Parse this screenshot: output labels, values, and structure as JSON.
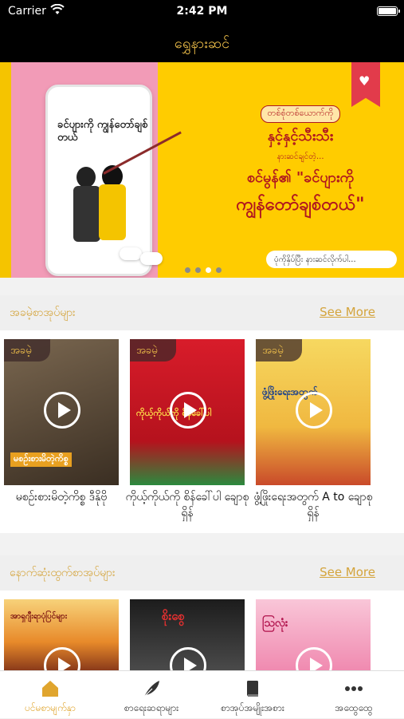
{
  "status_bar": {
    "carrier": "Carrier",
    "time": "2:42 PM"
  },
  "nav": {
    "title": "ရွှေနားဆင်"
  },
  "banner": {
    "phone_book_title": "ခင်ပျားကို ကျွန်တော်ချစ်တယ်",
    "promo_line1": "တစ်စုံတစ်ယောက်ကို",
    "promo_line2": "နှင့်နှင့်သီးသီး",
    "promo_line3": "နားဆင်ချင်တဲ့...",
    "promo_line4": "စင်မွန်၏ \"ခင်ပျားကို",
    "promo_line5": "ကျွန်တော်ချစ်တယ်\"",
    "caption": "ပုံကိုနှိပ်ပြီး နားဆင်လိုက်ပါ...",
    "slide_count": 4,
    "active_slide": 3
  },
  "sections": [
    {
      "title": "အခမဲ့စာအုပ်များ",
      "see_more": "See More",
      "books": [
        {
          "tag": "အခမဲ့",
          "cover_text": "မစဥ်းစားမိတဲ့ကိစ္စ",
          "caption": "မစဥ်းစားမိတဲ့ကိစ္စ ဒီနိုဗို",
          "colors": [
            "#6b5a45",
            "#3d3024"
          ]
        },
        {
          "tag": "အခမဲ့",
          "cover_text": "ကိုယ့်ကိုယ်ကို စိန်ခေါ်ပါ",
          "caption": "ကိုယ့်ကိုယ်ကို စိန်ခေါ်ပါ ချောစုရှိန်",
          "colors": [
            "#e8222f",
            "#2b8a3e"
          ]
        },
        {
          "tag": "အခမဲ့",
          "cover_text": "ဖွံ့ဖြိုးရေးအတွက်",
          "caption": "ဖွံ့ဖြိုးရေးအတွက် A to ချောစုရှိန်",
          "colors": [
            "#f0c84c",
            "#c94a2a"
          ]
        }
      ]
    },
    {
      "title": "နောက်ဆုံးထွက်စာအုပ်များ",
      "see_more": "See More",
      "books": [
        {
          "cover_text": "အာရှဂျီးရာပုံပြင်များ",
          "colors": [
            "#f3a43a",
            "#8a3a1a"
          ]
        },
        {
          "cover_text": "စိုးစွေ",
          "colors": [
            "#222222",
            "#555555"
          ]
        },
        {
          "cover_text": "ဩလုံး",
          "colors": [
            "#f3a4c2",
            "#d83a7a"
          ]
        }
      ]
    }
  ],
  "tabbar": {
    "items": [
      {
        "label": "ပင်မစာမျက်နှာ",
        "icon": "home-icon",
        "active": true
      },
      {
        "label": "စာရေးဆရာများ",
        "icon": "feather-icon",
        "active": false
      },
      {
        "label": "စာအုပ်အမျိုးအစား",
        "icon": "book-icon",
        "active": false
      },
      {
        "label": "အထွေထွေ",
        "icon": "more-icon",
        "active": false
      }
    ]
  },
  "colors": {
    "accent": "#e0a52e",
    "banner_bg": "#ffcc00",
    "banner_pink": "#f29bb7"
  }
}
